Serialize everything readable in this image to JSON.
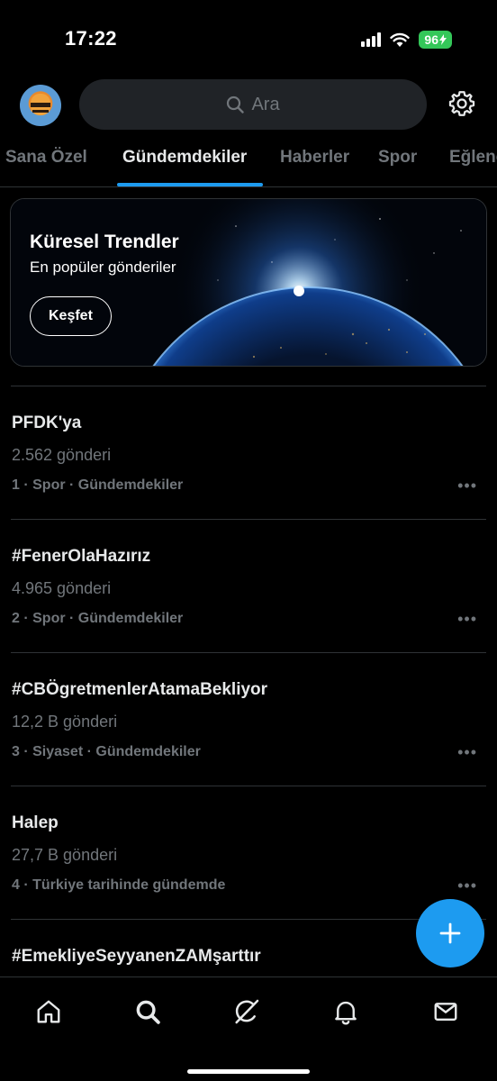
{
  "status_bar": {
    "time": "17:22",
    "battery": "96"
  },
  "header": {
    "search_placeholder": "Ara"
  },
  "tabs": [
    {
      "label": "Sana Özel",
      "active": false
    },
    {
      "label": "Gündemdekiler",
      "active": true
    },
    {
      "label": "Haberler",
      "active": false
    },
    {
      "label": "Spor",
      "active": false
    },
    {
      "label": "Eğlence",
      "active": false
    }
  ],
  "banner": {
    "title": "Küresel Trendler",
    "subtitle": "En popüler gönderiler",
    "button": "Keşfet"
  },
  "trends": [
    {
      "title": "PFDK'ya",
      "count": "2.562 gönderi",
      "meta": "1 · Spor · Gündemdekiler"
    },
    {
      "title": "#FenerOlaHazırız",
      "count": "4.965 gönderi",
      "meta": "2 · Spor · Gündemdekiler"
    },
    {
      "title": "#CBÖgretmenlerAtamaBekliyor",
      "count": "12,2 B gönderi",
      "meta": "3 · Siyaset · Gündemdekiler"
    },
    {
      "title": "Halep",
      "count": "27,7 B gönderi",
      "meta": "4 · Türkiye tarihinde gündemde"
    },
    {
      "title": "#EmekliyeSeyyanenZAMşarttır",
      "count": "",
      "meta": ""
    }
  ],
  "icons": {
    "search": "search-icon",
    "settings": "gear-icon",
    "fab": "plus-icon",
    "nav": [
      "home-icon",
      "search-icon",
      "grok-icon",
      "bell-icon",
      "mail-icon"
    ]
  },
  "colors": {
    "accent": "#1d9bf0",
    "battery": "#34c759",
    "muted": "#71767b",
    "background": "#000000"
  }
}
